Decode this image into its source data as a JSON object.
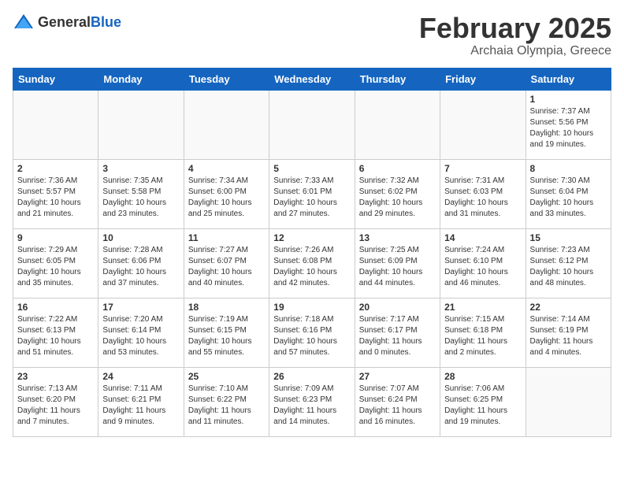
{
  "header": {
    "logo_general": "General",
    "logo_blue": "Blue",
    "title": "February 2025",
    "location": "Archaia Olympia, Greece"
  },
  "weekdays": [
    "Sunday",
    "Monday",
    "Tuesday",
    "Wednesday",
    "Thursday",
    "Friday",
    "Saturday"
  ],
  "weeks": [
    [
      {
        "day": "",
        "info": ""
      },
      {
        "day": "",
        "info": ""
      },
      {
        "day": "",
        "info": ""
      },
      {
        "day": "",
        "info": ""
      },
      {
        "day": "",
        "info": ""
      },
      {
        "day": "",
        "info": ""
      },
      {
        "day": "1",
        "info": "Sunrise: 7:37 AM\nSunset: 5:56 PM\nDaylight: 10 hours and 19 minutes."
      }
    ],
    [
      {
        "day": "2",
        "info": "Sunrise: 7:36 AM\nSunset: 5:57 PM\nDaylight: 10 hours and 21 minutes."
      },
      {
        "day": "3",
        "info": "Sunrise: 7:35 AM\nSunset: 5:58 PM\nDaylight: 10 hours and 23 minutes."
      },
      {
        "day": "4",
        "info": "Sunrise: 7:34 AM\nSunset: 6:00 PM\nDaylight: 10 hours and 25 minutes."
      },
      {
        "day": "5",
        "info": "Sunrise: 7:33 AM\nSunset: 6:01 PM\nDaylight: 10 hours and 27 minutes."
      },
      {
        "day": "6",
        "info": "Sunrise: 7:32 AM\nSunset: 6:02 PM\nDaylight: 10 hours and 29 minutes."
      },
      {
        "day": "7",
        "info": "Sunrise: 7:31 AM\nSunset: 6:03 PM\nDaylight: 10 hours and 31 minutes."
      },
      {
        "day": "8",
        "info": "Sunrise: 7:30 AM\nSunset: 6:04 PM\nDaylight: 10 hours and 33 minutes."
      }
    ],
    [
      {
        "day": "9",
        "info": "Sunrise: 7:29 AM\nSunset: 6:05 PM\nDaylight: 10 hours and 35 minutes."
      },
      {
        "day": "10",
        "info": "Sunrise: 7:28 AM\nSunset: 6:06 PM\nDaylight: 10 hours and 37 minutes."
      },
      {
        "day": "11",
        "info": "Sunrise: 7:27 AM\nSunset: 6:07 PM\nDaylight: 10 hours and 40 minutes."
      },
      {
        "day": "12",
        "info": "Sunrise: 7:26 AM\nSunset: 6:08 PM\nDaylight: 10 hours and 42 minutes."
      },
      {
        "day": "13",
        "info": "Sunrise: 7:25 AM\nSunset: 6:09 PM\nDaylight: 10 hours and 44 minutes."
      },
      {
        "day": "14",
        "info": "Sunrise: 7:24 AM\nSunset: 6:10 PM\nDaylight: 10 hours and 46 minutes."
      },
      {
        "day": "15",
        "info": "Sunrise: 7:23 AM\nSunset: 6:12 PM\nDaylight: 10 hours and 48 minutes."
      }
    ],
    [
      {
        "day": "16",
        "info": "Sunrise: 7:22 AM\nSunset: 6:13 PM\nDaylight: 10 hours and 51 minutes."
      },
      {
        "day": "17",
        "info": "Sunrise: 7:20 AM\nSunset: 6:14 PM\nDaylight: 10 hours and 53 minutes."
      },
      {
        "day": "18",
        "info": "Sunrise: 7:19 AM\nSunset: 6:15 PM\nDaylight: 10 hours and 55 minutes."
      },
      {
        "day": "19",
        "info": "Sunrise: 7:18 AM\nSunset: 6:16 PM\nDaylight: 10 hours and 57 minutes."
      },
      {
        "day": "20",
        "info": "Sunrise: 7:17 AM\nSunset: 6:17 PM\nDaylight: 11 hours and 0 minutes."
      },
      {
        "day": "21",
        "info": "Sunrise: 7:15 AM\nSunset: 6:18 PM\nDaylight: 11 hours and 2 minutes."
      },
      {
        "day": "22",
        "info": "Sunrise: 7:14 AM\nSunset: 6:19 PM\nDaylight: 11 hours and 4 minutes."
      }
    ],
    [
      {
        "day": "23",
        "info": "Sunrise: 7:13 AM\nSunset: 6:20 PM\nDaylight: 11 hours and 7 minutes."
      },
      {
        "day": "24",
        "info": "Sunrise: 7:11 AM\nSunset: 6:21 PM\nDaylight: 11 hours and 9 minutes."
      },
      {
        "day": "25",
        "info": "Sunrise: 7:10 AM\nSunset: 6:22 PM\nDaylight: 11 hours and 11 minutes."
      },
      {
        "day": "26",
        "info": "Sunrise: 7:09 AM\nSunset: 6:23 PM\nDaylight: 11 hours and 14 minutes."
      },
      {
        "day": "27",
        "info": "Sunrise: 7:07 AM\nSunset: 6:24 PM\nDaylight: 11 hours and 16 minutes."
      },
      {
        "day": "28",
        "info": "Sunrise: 7:06 AM\nSunset: 6:25 PM\nDaylight: 11 hours and 19 minutes."
      },
      {
        "day": "",
        "info": ""
      }
    ]
  ]
}
